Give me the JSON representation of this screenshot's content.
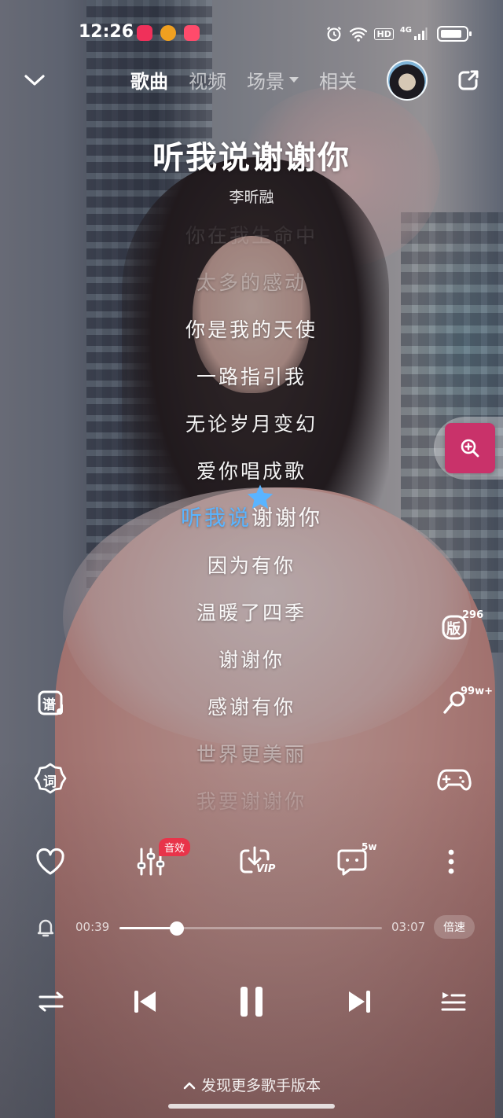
{
  "status_bar": {
    "time": "12:26",
    "network_label": "HD",
    "signal_label": "4G"
  },
  "header": {
    "tabs": [
      {
        "label": "歌曲",
        "active": true
      },
      {
        "label": "视频",
        "active": false
      },
      {
        "label": "场景",
        "active": false,
        "dropdown": true
      },
      {
        "label": "相关",
        "active": false
      }
    ]
  },
  "song": {
    "title": "听我说谢谢你",
    "artist": "李昕融"
  },
  "lyrics": {
    "lines": [
      "你在我生命中",
      "太多的感动",
      "你是我的天使",
      "一路指引我",
      "无论岁月变幻",
      "爱你唱成歌",
      "听我说谢谢你",
      "因为有你",
      "温暖了四季",
      "谢谢你",
      "感谢有你",
      "世界更美丽",
      "我要谢谢你"
    ],
    "current_index": 6,
    "current_sung": "听我说",
    "current_rest": "谢谢你",
    "highlight_color": "#5ab4ff"
  },
  "side_buttons": {
    "score_label": "谱",
    "lyrics_label": "词",
    "versions_label": "版",
    "versions_count": "296",
    "ringtone_count": "99w+"
  },
  "actions": {
    "sound_effect_badge": "音效",
    "download_label": "VIP",
    "comment_count": "5w"
  },
  "playback": {
    "current_time": "00:39",
    "total_time": "03:07",
    "progress": 0.22,
    "speed_label": "倍速"
  },
  "footer": {
    "more_versions": "发现更多歌手版本"
  },
  "colors": {
    "accent_blue": "#5ab4ff",
    "badge_red": "#e8344a",
    "zoom_pink": "#c9326a"
  }
}
